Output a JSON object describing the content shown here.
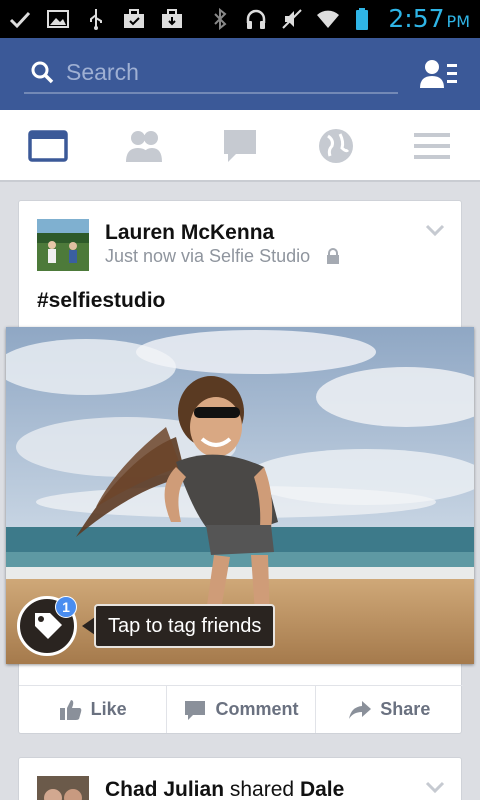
{
  "status_bar": {
    "time": "2:57",
    "ampm": "PM",
    "icons": [
      "check-icon",
      "image-icon",
      "usb-icon",
      "briefcase-icon",
      "briefcase-icon",
      "bluetooth-icon",
      "headset-icon",
      "mute-icon",
      "wifi-icon",
      "battery-icon"
    ]
  },
  "header": {
    "search_placeholder": "Search",
    "friend_requests_icon": "friend-requests-icon"
  },
  "tabs": [
    "news-feed-icon",
    "friends-icon",
    "messages-icon",
    "notifications-globe-icon",
    "menu-icon"
  ],
  "colors": {
    "brand": "#3b5998",
    "status_accent": "#2fb5e6"
  },
  "posts": [
    {
      "author": "Lauren McKenna",
      "meta": "Just now via Selfie Studio",
      "text": "#selfiestudio",
      "tag_count": "1",
      "tag_tip": "Tap to tag friends",
      "actions": {
        "like": "Like",
        "comment": "Comment",
        "share": "Share"
      }
    },
    {
      "author": "Chad Julian",
      "shared": "shared",
      "shared_with": "Dale"
    }
  ]
}
